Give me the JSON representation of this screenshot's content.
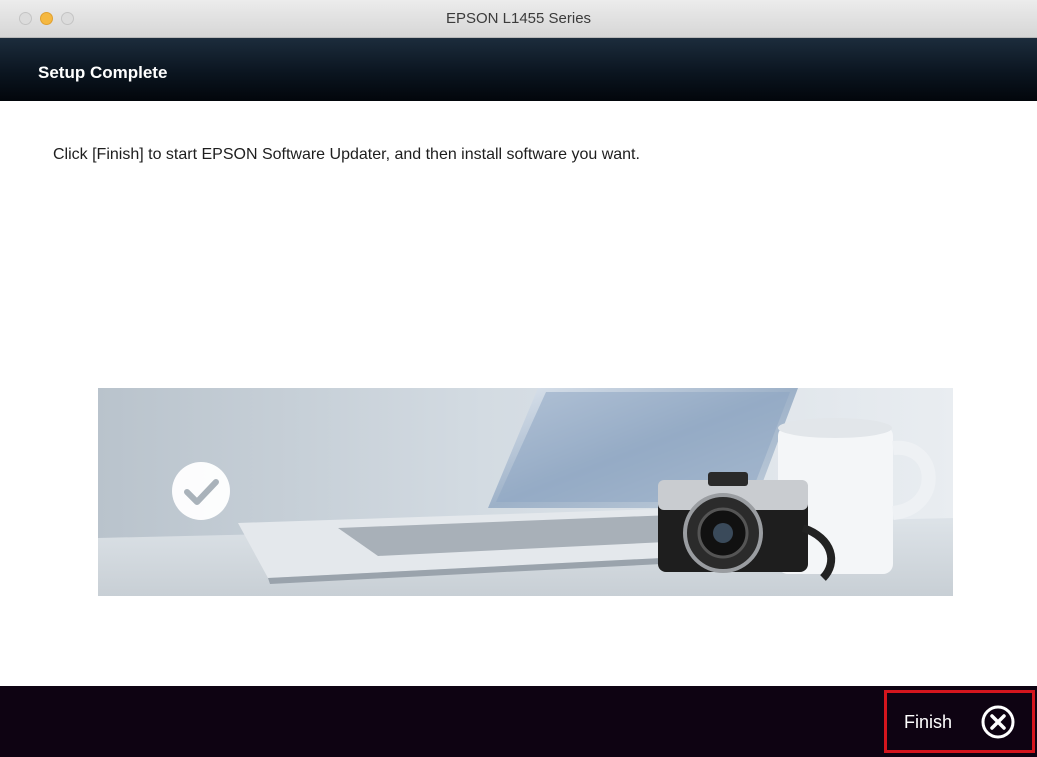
{
  "window": {
    "title": "EPSON L1455 Series",
    "traffic_lights": [
      "close-icon",
      "minimize-icon",
      "zoom-icon"
    ]
  },
  "header": {
    "title": "Setup Complete"
  },
  "main": {
    "instruction": "Click [Finish] to start EPSON Software Updater, and then install software you want.",
    "illustration": {
      "icon": "checkmark-icon",
      "depicts": [
        "laptop",
        "camera",
        "mug"
      ]
    }
  },
  "footer": {
    "finish_label": "Finish",
    "finish_icon": "close-circle-icon",
    "highlight_color": "#d4151d"
  },
  "colors": {
    "header_bg": "#0b1520",
    "footer_bg": "#0e0312",
    "traffic_minimize": "#f5b840"
  }
}
